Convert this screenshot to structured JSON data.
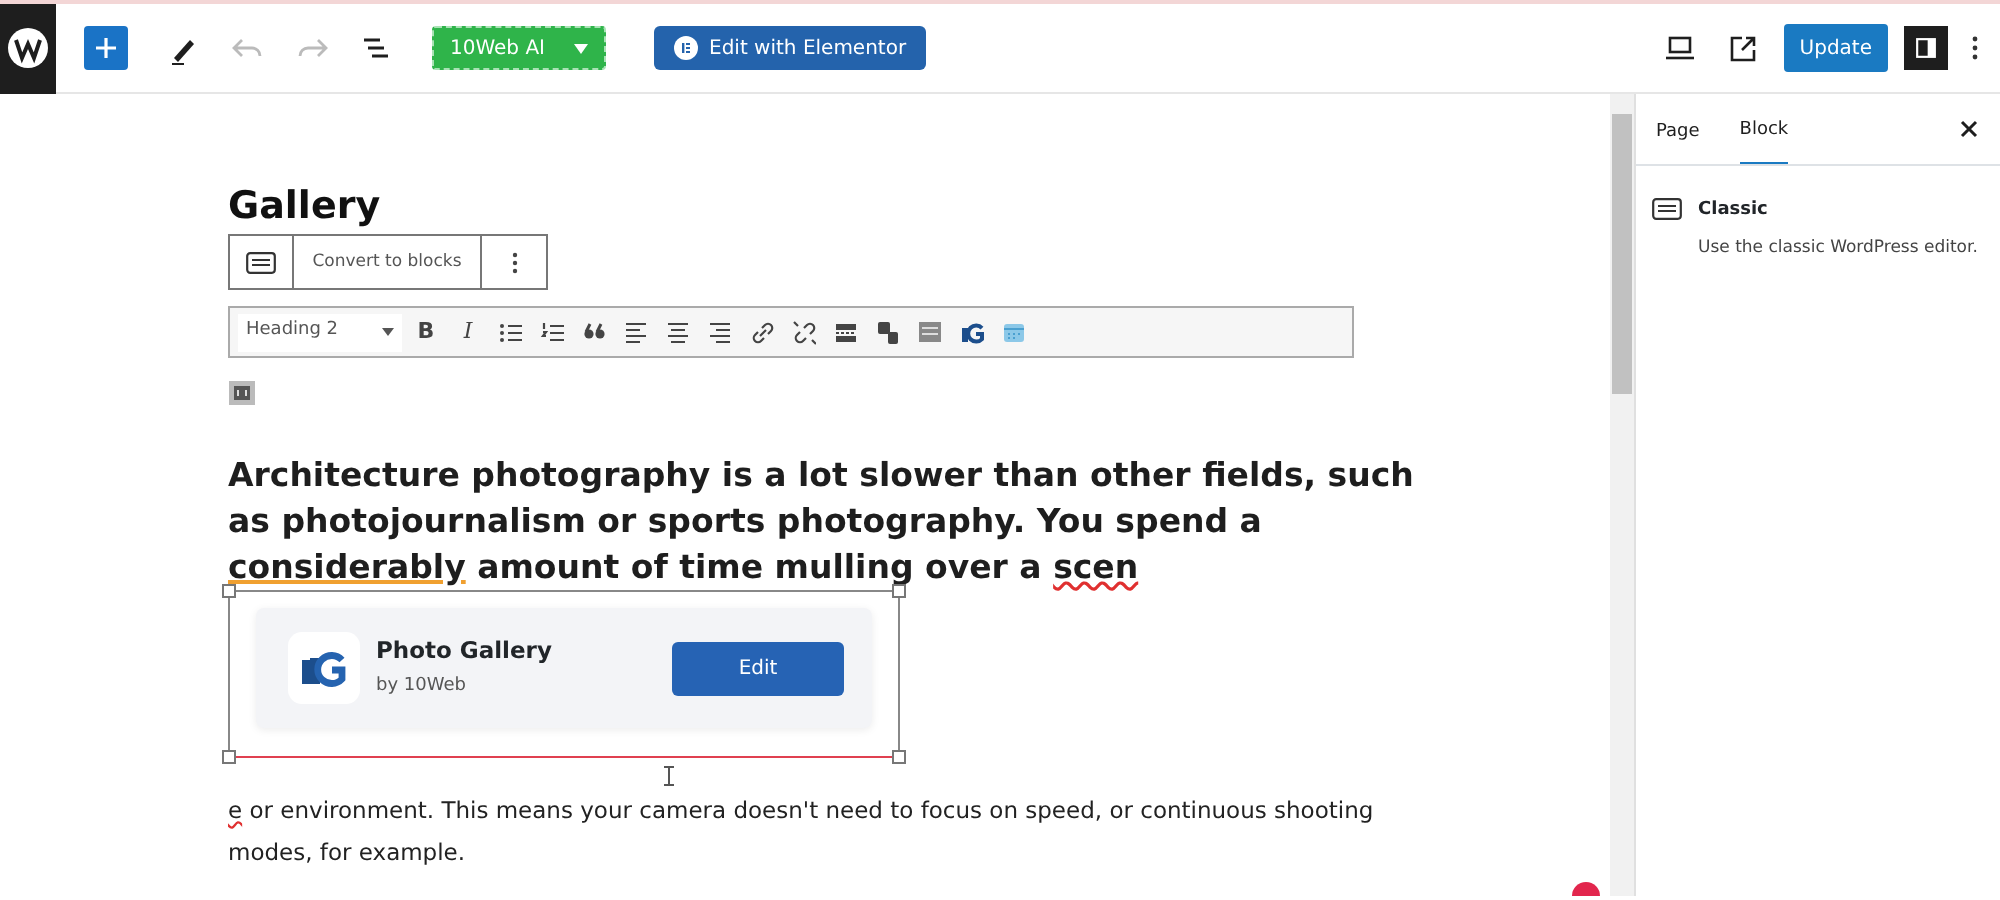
{
  "top_bar": {
    "ai_button": "10Web AI",
    "elementor_button": "Edit with Elementor",
    "update_button": "Update",
    "settings_open": true
  },
  "sidebar": {
    "tabs": [
      {
        "label": "Page",
        "selected": false
      },
      {
        "label": "Block",
        "selected": true
      }
    ],
    "block": {
      "title": "Classic",
      "description": "Use the classic WordPress editor."
    }
  },
  "editor": {
    "title": "Gallery",
    "block_toolbar": {
      "convert_label": "Convert to blocks"
    },
    "classic_toolbar": {
      "format": "Heading 2",
      "bold_label": "B",
      "italic_label": "I"
    },
    "heading": [
      {
        "text": "Architecture photography is a lot slower than other fields, such as photojournalism or sports photography. You spend a ",
        "kind": "plain"
      },
      {
        "text": "considerably",
        "kind": "grammar"
      },
      {
        "text": " amount of time mulling over a ",
        "kind": "plain"
      },
      {
        "text": "scen",
        "kind": "spelling"
      }
    ],
    "widget": {
      "title": "Photo Gallery",
      "subtitle": "by 10Web",
      "button": "Edit"
    },
    "paragraph": [
      {
        "text": "e",
        "kind": "spelling"
      },
      {
        "text": " or environment. This means your camera doesn't need to focus on speed, or continuous shooting modes, for example.",
        "kind": "plain"
      }
    ]
  }
}
